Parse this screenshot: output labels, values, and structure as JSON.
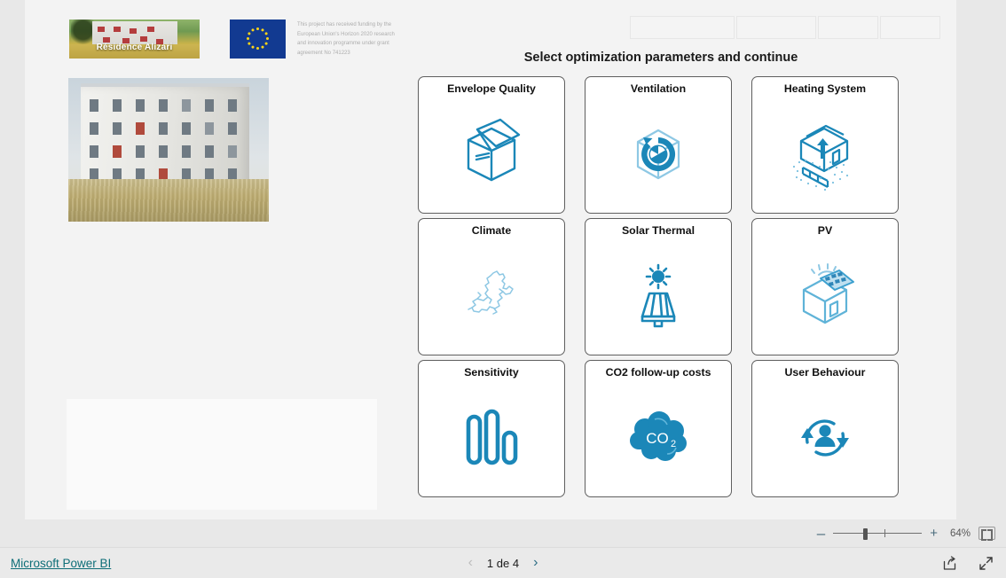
{
  "report": {
    "title": "Select optimization parameters and continue",
    "logos": {
      "project_logo_caption": "Résidence Alizari",
      "eu_flag_name": "european-union-flag",
      "funding_text": "This project has received funding by the European Union's Horizon 2020 research and innovation programme under grant agreement No 741223",
      "building_photo_name": "residence-alizari-building-photo"
    },
    "slicers": [
      {
        "name": "slicer-1",
        "value": ""
      },
      {
        "name": "slicer-2",
        "value": ""
      },
      {
        "name": "slicer-3",
        "value": ""
      },
      {
        "name": "slicer-4",
        "value": ""
      }
    ],
    "cards": [
      {
        "label": "Envelope Quality",
        "icon": "house-envelope-icon"
      },
      {
        "label": "Ventilation",
        "icon": "house-fan-icon"
      },
      {
        "label": "Heating System",
        "icon": "heat-pump-house-icon"
      },
      {
        "label": "Climate",
        "icon": "europe-map-icon"
      },
      {
        "label": "Solar Thermal",
        "icon": "solar-collector-sun-icon"
      },
      {
        "label": "PV",
        "icon": "pv-roof-house-icon"
      },
      {
        "label": "Sensitivity",
        "icon": "bar-chart-icon"
      },
      {
        "label": "CO2 follow-up costs",
        "icon": "co2-cloud-icon"
      },
      {
        "label": "User Behaviour",
        "icon": "user-cycle-icon"
      }
    ],
    "colors": {
      "icon_blue": "#1b87b8",
      "icon_light_blue": "#8ec8e4",
      "canvas": "#f3f3f3",
      "link_teal": "#0e6e78"
    }
  },
  "zoom_bar": {
    "minus_label": "–",
    "plus_label": "+",
    "zoom_level": "64%",
    "fit_button_name": "fit-to-page-button"
  },
  "status_bar": {
    "brand_link": "Microsoft Power BI",
    "prev_label": "‹",
    "next_label": "›",
    "pager_label": "1 de 4",
    "share_icon": "share-icon",
    "fullscreen_icon": "fullscreen-icon"
  }
}
